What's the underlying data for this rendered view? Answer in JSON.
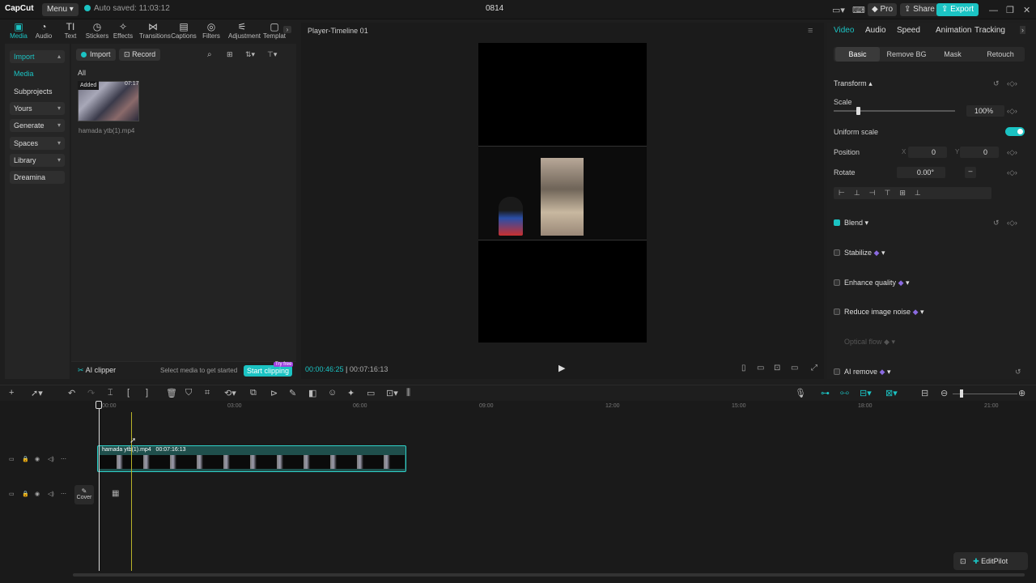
{
  "topbar": {
    "logo": "CapCut",
    "menu": "Menu",
    "autosave": "Auto saved: 11:03:12",
    "title": "0814",
    "pro": "Pro",
    "share": "Share",
    "export": "Export"
  },
  "toolbar": {
    "items": [
      "Media",
      "Audio",
      "Text",
      "Stickers",
      "Effects",
      "Transitions",
      "Captions",
      "Filters",
      "Adjustment",
      "Templat"
    ]
  },
  "leftnav": {
    "import": "Import",
    "media": "Media",
    "subprojects": "Subprojects",
    "yours": "Yours",
    "generate": "Generate",
    "spaces": "Spaces",
    "library": "Library",
    "dreamina": "Dreamina"
  },
  "media": {
    "import_btn": "Import",
    "record_btn": "Record",
    "filter_all": "All",
    "item": {
      "badge": "Added",
      "duration": "07:17",
      "filename": "hamada ytb(1).mp4"
    }
  },
  "aiclipper": {
    "label": "AI clipper",
    "hint": "Select media to get started",
    "button": "Start clipping",
    "tag": "Try free"
  },
  "player": {
    "title": "Player-Timeline 01",
    "current_time": "00:00:46:25",
    "total_time": "00:07:16:13"
  },
  "inspector": {
    "tabs": [
      "Video",
      "Audio",
      "Speed",
      "Animation",
      "Tracking"
    ],
    "subtabs": [
      "Basic",
      "Remove BG",
      "Mask",
      "Retouch"
    ],
    "transform": "Transform",
    "scale_label": "Scale",
    "scale_value": "100%",
    "uniform_scale": "Uniform scale",
    "position_label": "Position",
    "pos_x_label": "X",
    "pos_x": "0",
    "pos_y_label": "Y",
    "pos_y": "0",
    "rotate_label": "Rotate",
    "rotate_value": "0.00°",
    "blend": "Blend",
    "stabilize": "Stabilize",
    "enhance_quality": "Enhance quality",
    "reduce_noise": "Reduce image noise",
    "optical_flow": "Optical flow",
    "ai_remove": "AI remove"
  },
  "timeline": {
    "ticks": [
      "00:00",
      "03:00",
      "06:00",
      "09:00",
      "12:00",
      "15:00",
      "18:00",
      "21:00"
    ],
    "clip_name": "hamada ytb(1).mp4",
    "clip_duration": "00:07:16:13",
    "cover": "Cover",
    "editpilot": "EditPilot"
  }
}
